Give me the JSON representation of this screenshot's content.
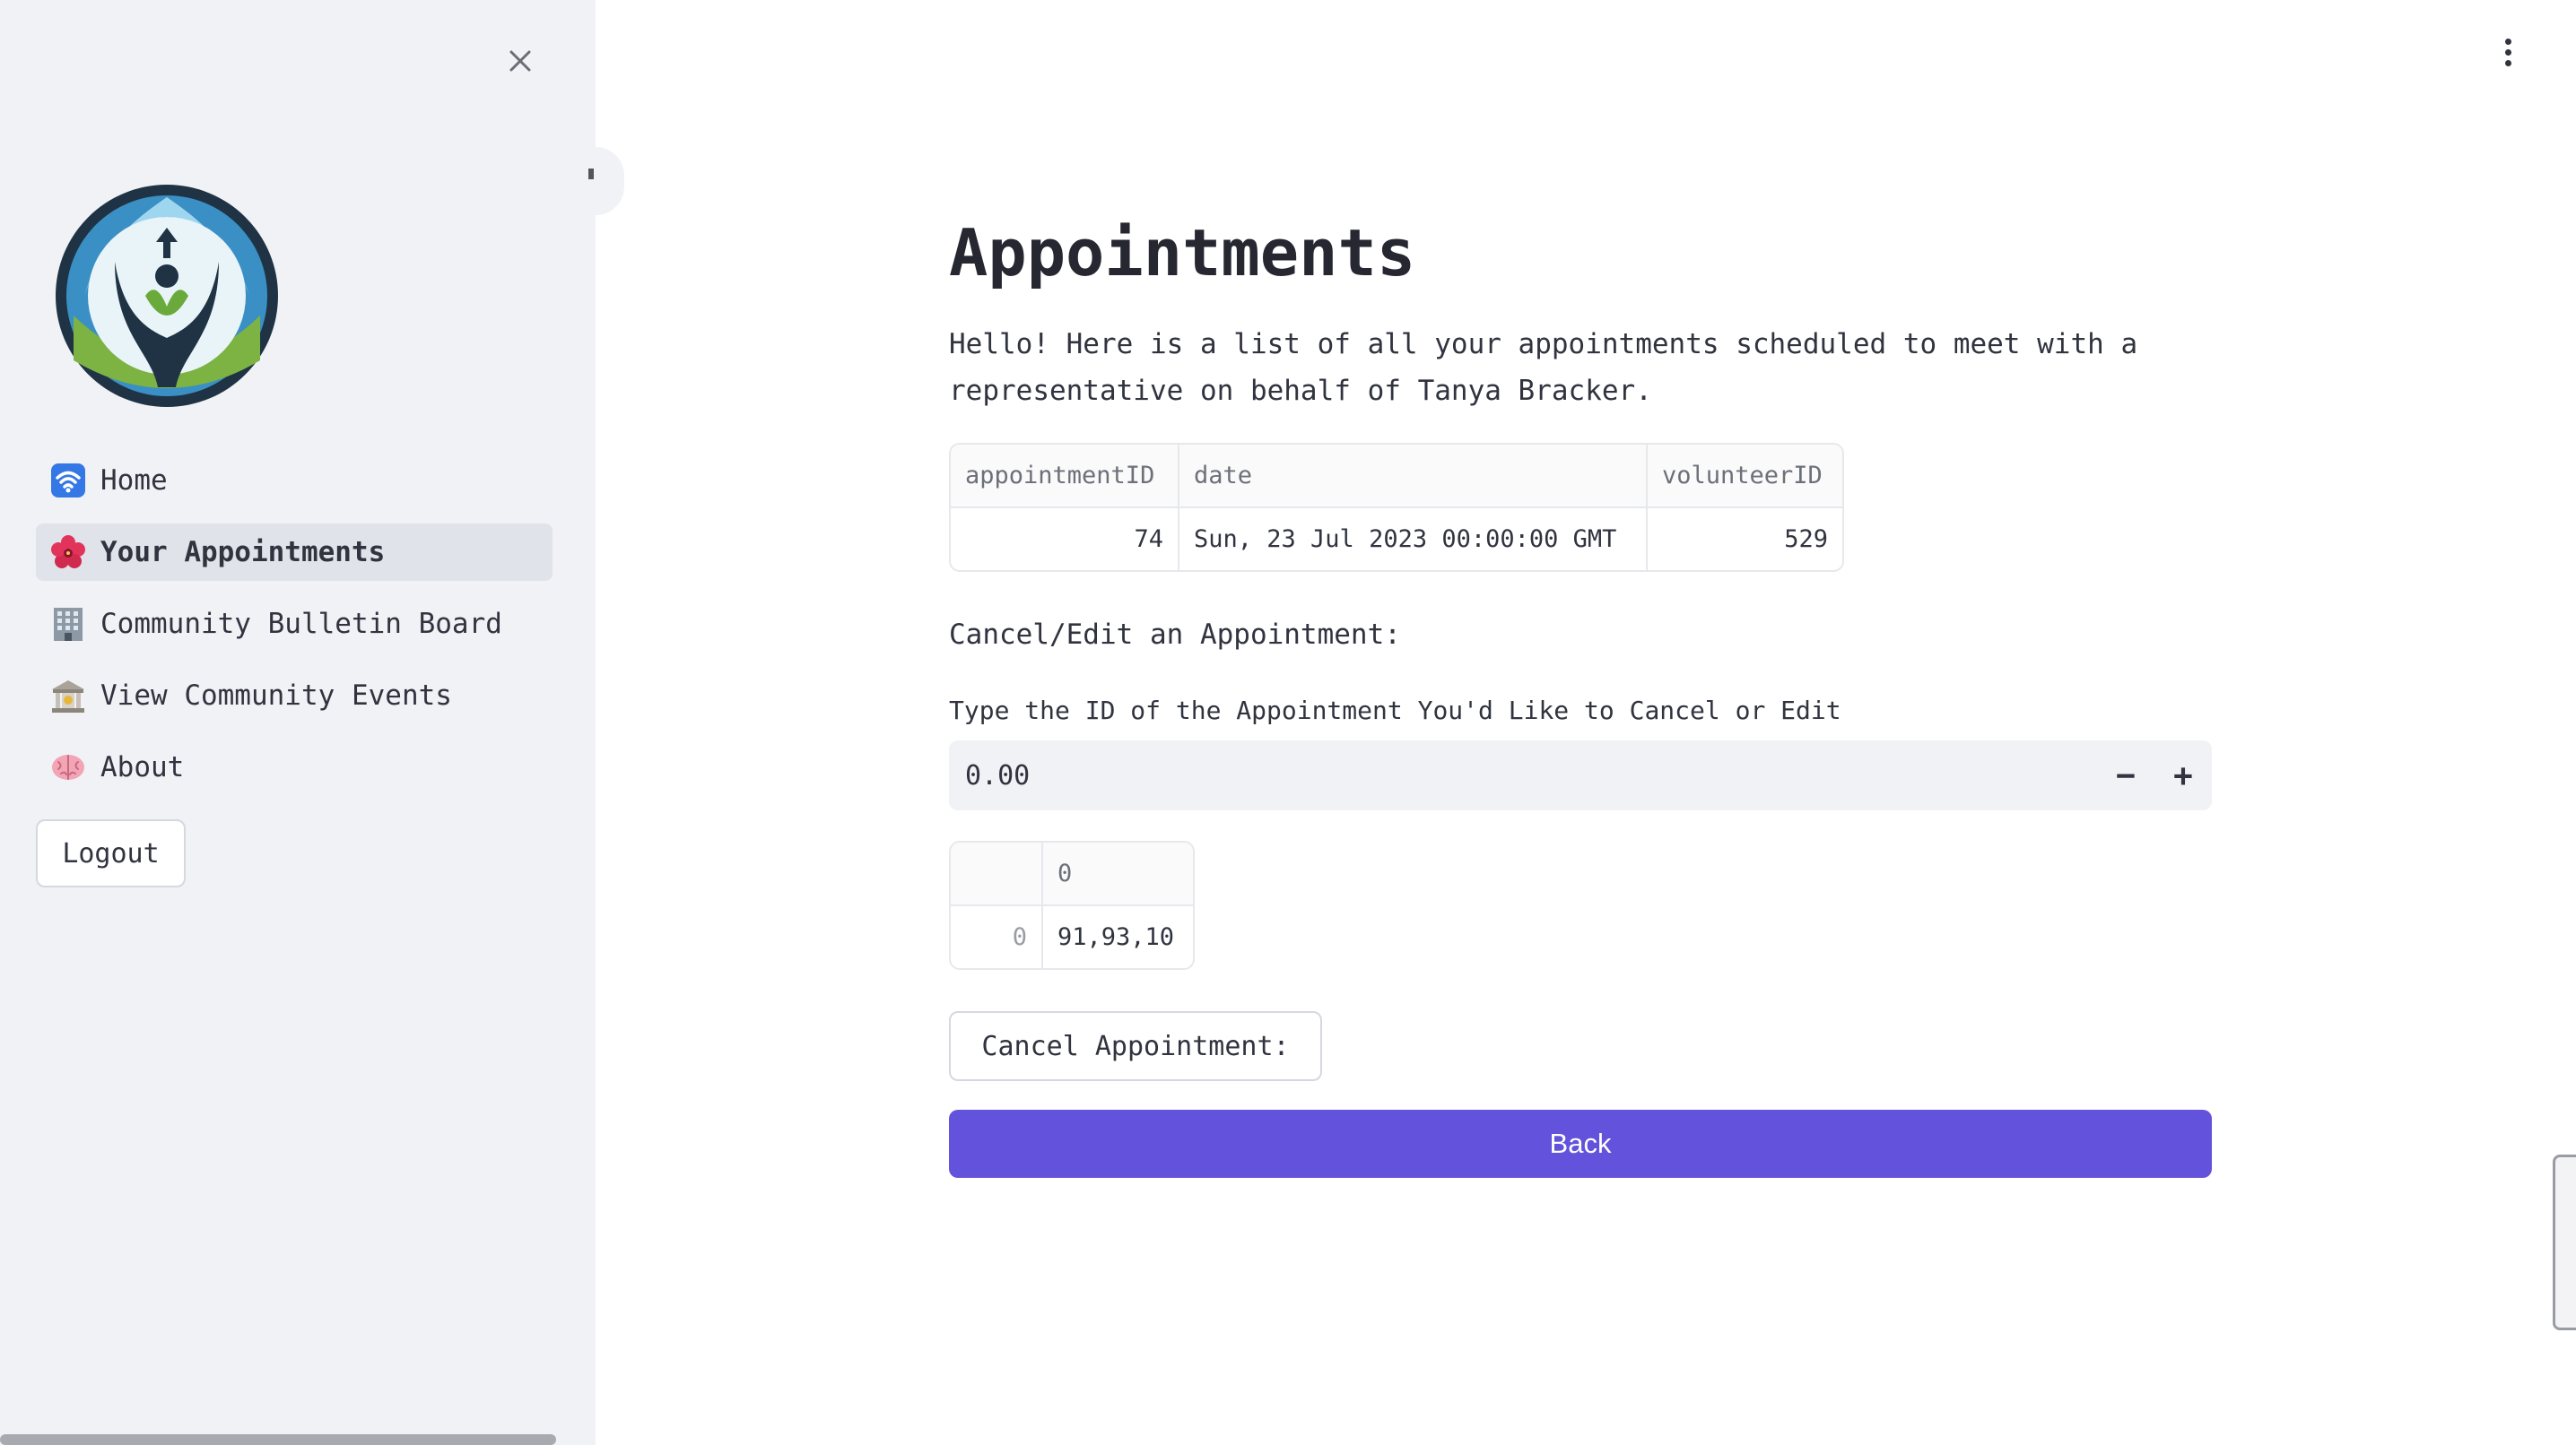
{
  "sidebar": {
    "items": [
      {
        "label": "Home",
        "icon": "wifi-icon",
        "active": false
      },
      {
        "label": "Your Appointments",
        "icon": "hibiscus-icon",
        "active": true
      },
      {
        "label": "Community Bulletin Board",
        "icon": "office-building-icon",
        "active": false
      },
      {
        "label": "View Community Events",
        "icon": "bank-icon",
        "active": false
      },
      {
        "label": "About",
        "icon": "brain-icon",
        "active": false
      }
    ],
    "logout_label": "Logout"
  },
  "main": {
    "title": "Appointments",
    "intro": "Hello! Here is a list of all your appointments scheduled to meet with a representative on behalf of Tanya Bracker.",
    "appointments_table": {
      "columns": [
        "appointmentID",
        "date",
        "volunteerID"
      ],
      "rows": [
        [
          "74",
          "Sun, 23 Jul 2023 00:00:00 GMT",
          "529"
        ]
      ]
    },
    "section_label": "Cancel/Edit an Appointment:",
    "field_label": "Type the ID of the Appointment You'd Like to Cancel or Edit",
    "stepper": {
      "value": "0.00",
      "minus": "−",
      "plus": "+"
    },
    "df_table": {
      "header": [
        "",
        "0"
      ],
      "rows": [
        [
          "0",
          "91,93,10"
        ]
      ]
    },
    "cancel_label": "Cancel Appointment:",
    "back_label": "Back"
  },
  "colors": {
    "accent": "#6352db",
    "sidebar_bg": "#f0f2f6"
  }
}
